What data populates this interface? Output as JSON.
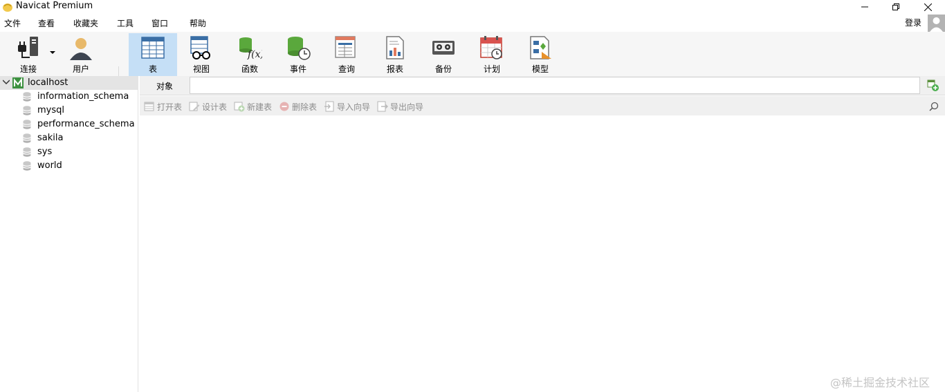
{
  "window": {
    "title": "Navicat Premium"
  },
  "menu": [
    "文件",
    "查看",
    "收藏夹",
    "工具",
    "窗口",
    "帮助"
  ],
  "login_label": "登录",
  "toolbar": {
    "connect": "连接",
    "user": "用户",
    "table": "表",
    "view": "视图",
    "function": "函数",
    "event": "事件",
    "query": "查询",
    "report": "报表",
    "backup": "备份",
    "schedule": "计划",
    "model": "模型"
  },
  "nav": {
    "connection": "localhost",
    "databases": [
      "information_schema",
      "mysql",
      "performance_schema",
      "sakila",
      "sys",
      "world"
    ]
  },
  "tabs": {
    "objects": "对象"
  },
  "object_toolbar": {
    "open_table": "打开表",
    "design_table": "设计表",
    "new_table": "新建表",
    "delete_table": "删除表",
    "import_wizard": "导入向导",
    "export_wizard": "导出向导"
  },
  "watermark": "@稀土掘金技术社区",
  "colors": {
    "active_tool": "#c5dff6",
    "toolbar_bg": "#f6f6f6",
    "nav_selected": "#e4e4e4"
  }
}
